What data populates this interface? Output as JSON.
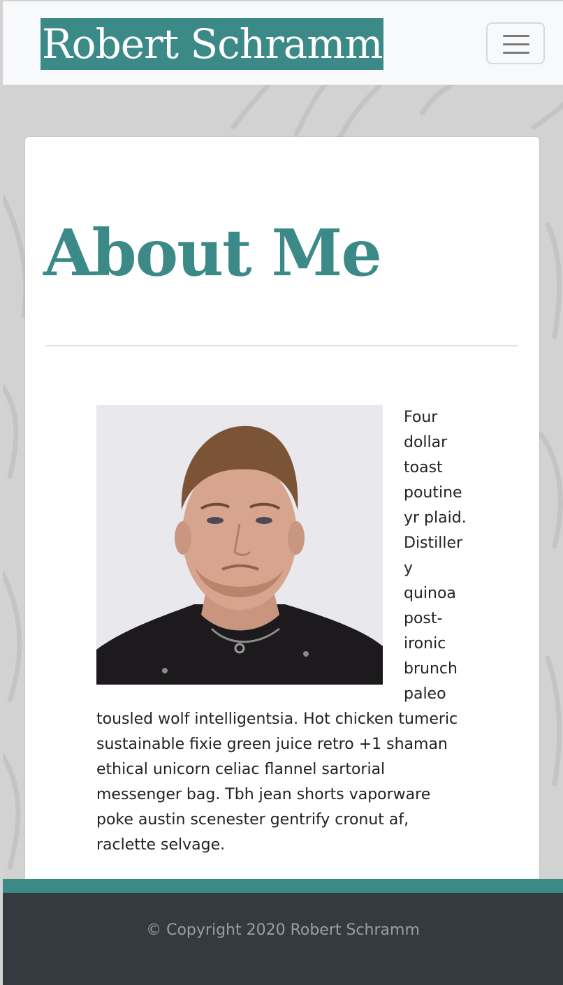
{
  "navbar": {
    "brand": "Robert Schramm",
    "toggler_icon": "hamburger-menu-icon"
  },
  "main": {
    "heading": "About Me",
    "photo_alt": "portrait-photo",
    "bio": "Four dollar toast poutine yr plaid. Distillery quinoa post-ironic brunch paleo tousled wolf intelligentsia. Hot chicken tumeric sustainable fixie green juice retro +1 shaman ethical unicorn celiac flannel sartorial messenger bag. Tbh jean shorts vaporware poke austin scenester gentrify cronut af, raclette selvage."
  },
  "footer": {
    "copyright": "© Copyright 2020 Robert Schramm"
  },
  "colors": {
    "accent": "#3c8a88",
    "footer": "#343a40",
    "navbar": "#f8f9fa"
  }
}
